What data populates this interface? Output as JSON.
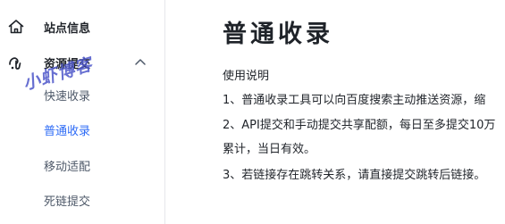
{
  "sidebar": {
    "items": [
      {
        "label": "站点信息",
        "icon": "home-icon"
      },
      {
        "label": "资源提交",
        "icon": "resource-link-icon",
        "expanded": true,
        "chevron": "chevron-up-icon",
        "children": [
          {
            "label": "快速收录",
            "active": false
          },
          {
            "label": "普通收录",
            "active": true
          },
          {
            "label": "移动适配",
            "active": false
          },
          {
            "label": "死链提交",
            "active": false
          }
        ]
      }
    ],
    "watermark": "小虾博客"
  },
  "main": {
    "title": "普通收录",
    "usage_title": "使用说明",
    "usage_lines": [
      "1、普通收录工具可以向百度搜索主动推送资源，缩",
      "2、API提交和手动提交共享配额，每日至多提交10万",
      "累计，当日有效。",
      "3、若链接存在跳转关系，请直接提交跳转后链接。"
    ]
  },
  "colors": {
    "accent": "#2d6bf6",
    "text": "#1f2329",
    "muted": "#4e5969",
    "watermark": "#4d56c9",
    "divider": "#e6e7eb"
  }
}
